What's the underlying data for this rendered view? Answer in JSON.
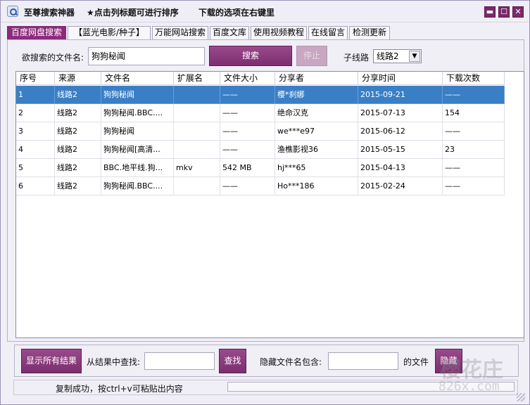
{
  "titlebar": {
    "app_title": "至尊搜索神器",
    "hint_sort": "★点击列标题可进行排序",
    "hint_right": "下载的选项在右键里",
    "minimize_glyph": "▬",
    "maximize_glyph": "☐",
    "close_glyph": "✕"
  },
  "tabs": [
    {
      "label": "百度网盘搜索",
      "active": true
    },
    {
      "label": "【蓝光电影/种子】",
      "active": false
    },
    {
      "label": "万能网站搜索",
      "active": false
    },
    {
      "label": "百度文库",
      "active": false
    },
    {
      "label": "使用视频教程",
      "active": false
    },
    {
      "label": "在线留言",
      "active": false
    },
    {
      "label": "检测更新",
      "active": false
    }
  ],
  "search": {
    "label": "欲搜索的文件名:",
    "value": "狗狗秘闻",
    "search_button": "搜索",
    "stop_button": "停止",
    "route_label": "子线路",
    "route_value": "线路2"
  },
  "table": {
    "columns": [
      "序号",
      "来源",
      "文件名",
      "扩展名",
      "文件大小",
      "分享者",
      "分享时间",
      "下载次数"
    ],
    "rows": [
      {
        "no": "1",
        "source": "线路2",
        "name": "狗狗秘闻",
        "ext": "",
        "size": "——",
        "sharer": "樱*刹娜",
        "time": "2015-09-21",
        "downloads": "——",
        "selected": true
      },
      {
        "no": "2",
        "source": "线路2",
        "name": "狗狗秘闻.BBC....",
        "ext": "",
        "size": "——",
        "sharer": "绝命汉克",
        "time": "2015-07-13",
        "downloads": "154",
        "selected": false
      },
      {
        "no": "3",
        "source": "线路2",
        "name": "狗狗秘闻",
        "ext": "",
        "size": "——",
        "sharer": "we***e97",
        "time": "2015-06-12",
        "downloads": "——",
        "selected": false
      },
      {
        "no": "4",
        "source": "线路2",
        "name": "狗狗秘闻[高清...",
        "ext": "",
        "size": "——",
        "sharer": "渔樵影视36",
        "time": "2015-05-15",
        "downloads": "23",
        "selected": false
      },
      {
        "no": "5",
        "source": "线路2",
        "name": "BBC.地平线.狗...",
        "ext": "mkv",
        "size": "542 MB",
        "sharer": "hj***65",
        "time": "2015-04-13",
        "downloads": "——",
        "selected": false
      },
      {
        "no": "6",
        "source": "线路2",
        "name": "狗狗秘闻.BBC....",
        "ext": "",
        "size": "——",
        "sharer": "Ho***186",
        "time": "2015-02-24",
        "downloads": "——",
        "selected": false
      }
    ]
  },
  "bottom": {
    "show_all_button": "显示所有结果",
    "find_label": "从结果中查找:",
    "find_value": "",
    "find_button": "查找",
    "hide_label": "隐藏文件名包含:",
    "hide_value": "",
    "hide_suffix": "的文件",
    "hide_button": "隐藏"
  },
  "status": {
    "message": "复制成功，按ctrl+v可粘贴出内容"
  },
  "watermark": {
    "text": "樱花庄",
    "url": "826x.com"
  },
  "colors": {
    "accent": "#8c2b7d",
    "selection": "#3a7fc6"
  }
}
